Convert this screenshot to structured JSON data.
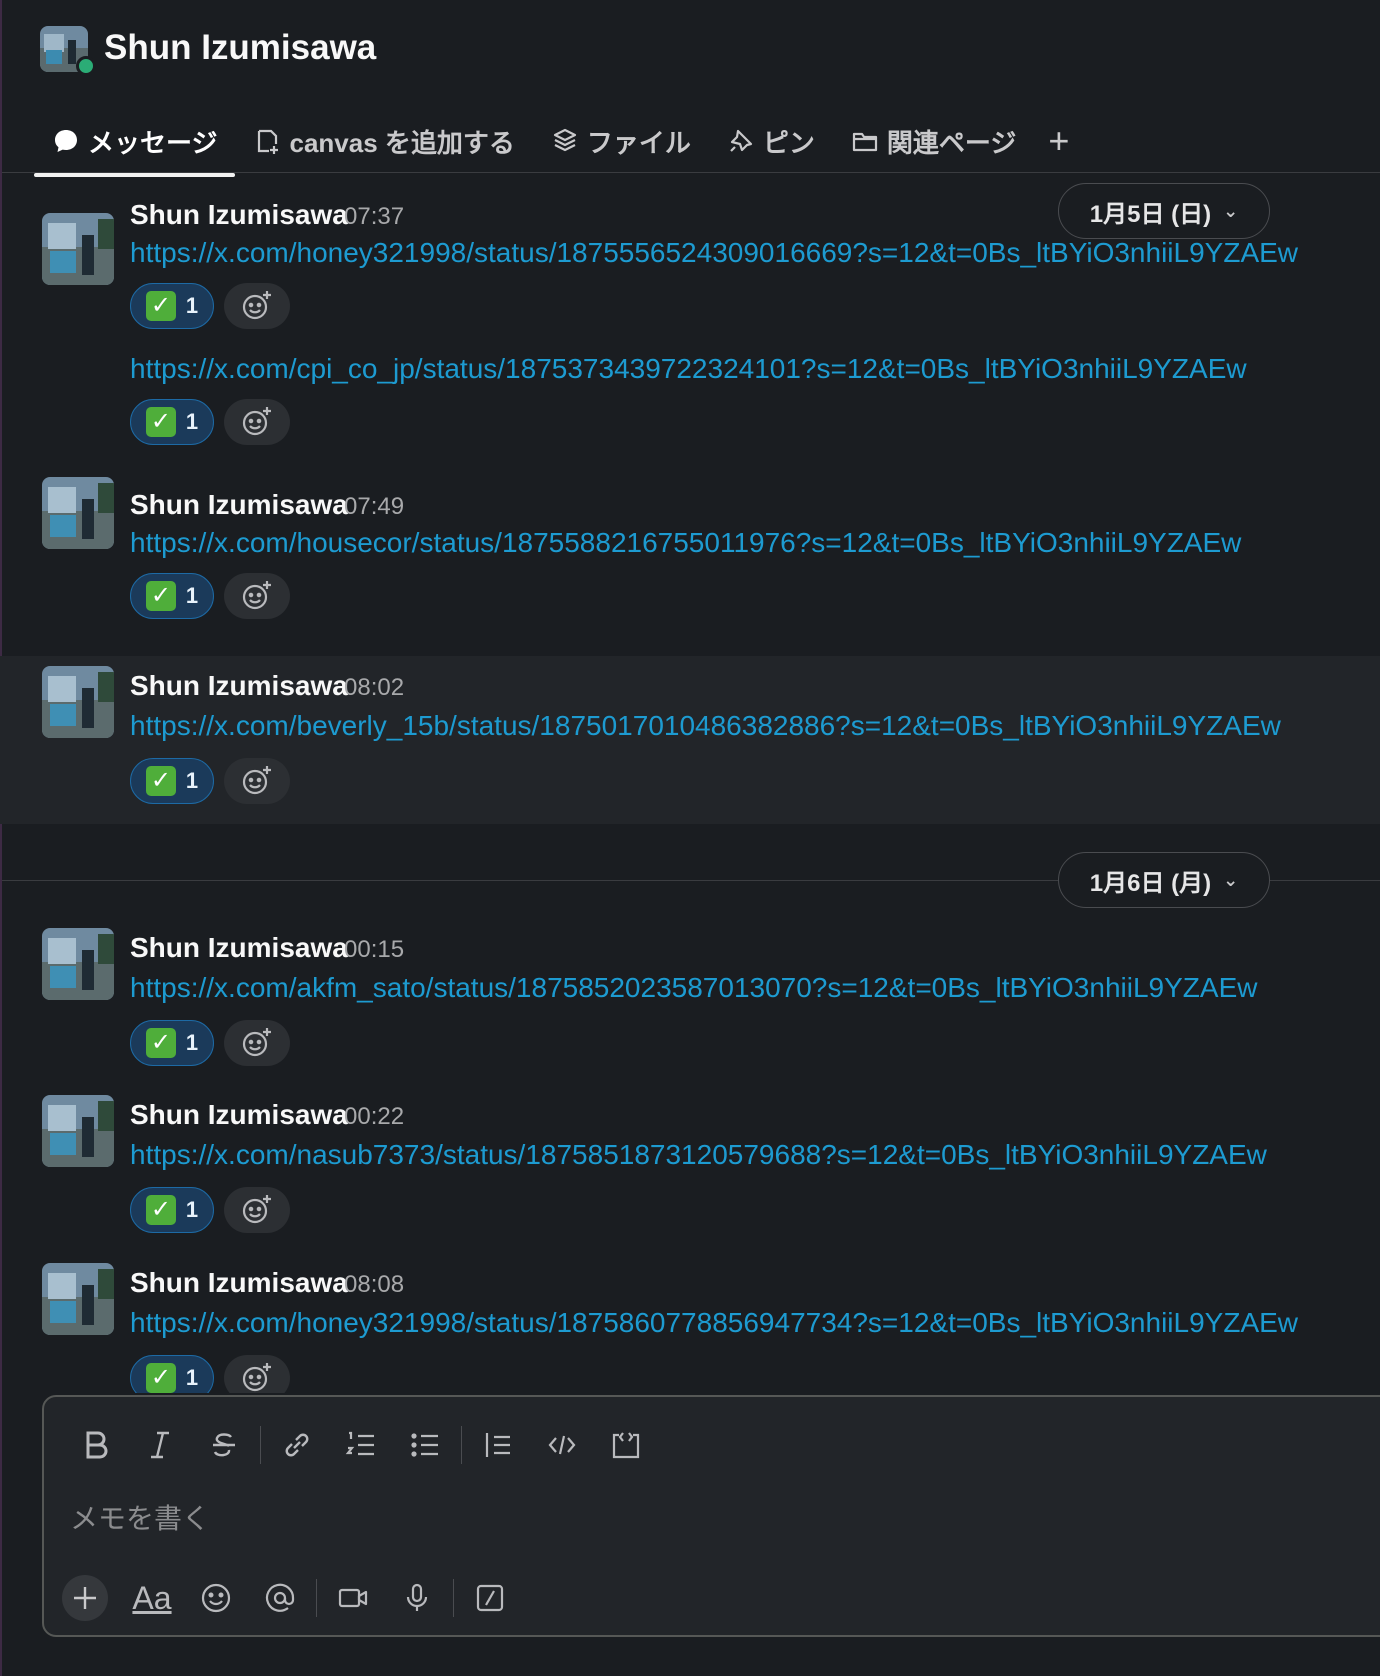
{
  "header": {
    "title": "Shun Izumisawa"
  },
  "tabs": [
    {
      "label": "メッセージ"
    },
    {
      "label": "canvas を追加する"
    },
    {
      "label": "ファイル"
    },
    {
      "label": "ピン"
    },
    {
      "label": "関連ページ"
    }
  ],
  "tab_add": "+",
  "date_separators": [
    {
      "label": "1月5日 (日)"
    },
    {
      "label": "1月6日 (月)"
    }
  ],
  "messages": [
    {
      "author": "Shun Izumisawa",
      "time": "07:37",
      "link": "https://x.com/honey321998/status/1875556524309016669?s=12&t=0Bs_ltBYiO3nhiiL9YZAEw",
      "reaction_count": "1"
    },
    {
      "author": "",
      "time": "",
      "link": "https://x.com/cpi_co_jp/status/1875373439722324101?s=12&t=0Bs_ltBYiO3nhiiL9YZAEw",
      "reaction_count": "1"
    },
    {
      "author": "Shun Izumisawa",
      "time": "07:49",
      "link": "https://x.com/housecor/status/1875588216755011976?s=12&t=0Bs_ltBYiO3nhiiL9YZAEw",
      "reaction_count": "1"
    },
    {
      "author": "Shun Izumisawa",
      "time": "08:02",
      "link": "https://x.com/beverly_15b/status/1875017010486382886?s=12&t=0Bs_ltBYiO3nhiiL9YZAEw",
      "reaction_count": "1"
    },
    {
      "author": "Shun Izumisawa",
      "time": "00:15",
      "link": "https://x.com/akfm_sato/status/1875852023587013070?s=12&t=0Bs_ltBYiO3nhiiL9YZAEw",
      "reaction_count": "1"
    },
    {
      "author": "Shun Izumisawa",
      "time": "00:22",
      "link": "https://x.com/nasub7373/status/1875851873120579688?s=12&t=0Bs_ltBYiO3nhiiL9YZAEw",
      "reaction_count": "1"
    },
    {
      "author": "Shun Izumisawa",
      "time": "08:08",
      "link": "https://x.com/honey321998/status/1875860778856947734?s=12&t=0Bs_ltBYiO3nhiiL9YZAEw",
      "reaction_count": "1"
    }
  ],
  "composer": {
    "placeholder": "メモを書く",
    "format_text_label": "Aa"
  },
  "colors": {
    "background": "#1a1d21",
    "link": "#1d9bd1",
    "reaction_bg": "#1b3a5a",
    "presence": "#2bac76"
  }
}
